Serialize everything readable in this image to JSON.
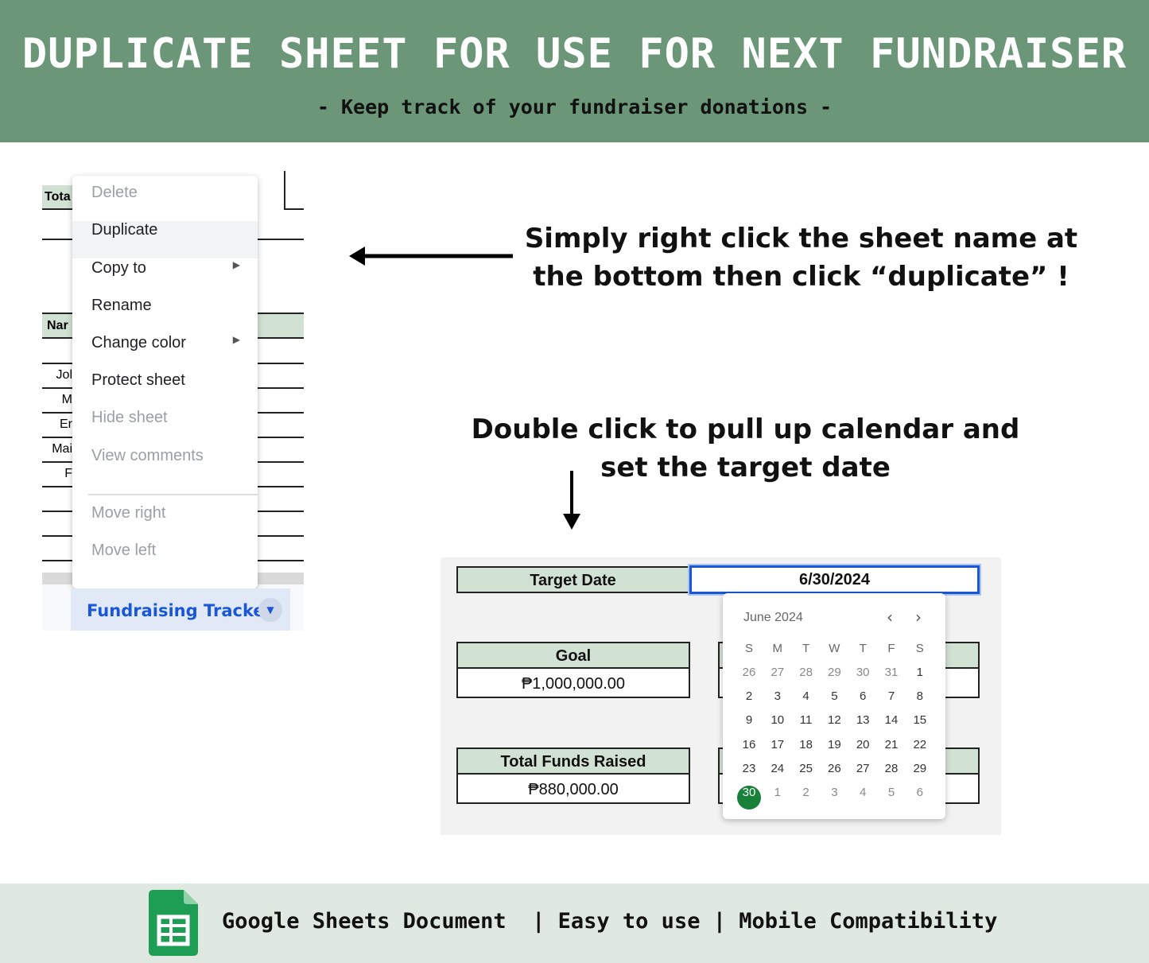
{
  "header": {
    "title": "DUPLICATE SHEET FOR USE FOR NEXT FUNDRAISER",
    "subtitle": "- Keep track of your fundraiser donations -",
    "bg": "#6b9678"
  },
  "sheet_snippet": {
    "visible_fragments": [
      "Tota",
      "Nar",
      "Jol",
      "M",
      "Er",
      "Mai",
      "F"
    ]
  },
  "context_menu": {
    "items": [
      {
        "label": "Delete",
        "disabled": true
      },
      {
        "label": "Duplicate",
        "disabled": false,
        "highlighted": true
      },
      {
        "label": "Copy to",
        "disabled": false,
        "submenu": true
      },
      {
        "label": "Rename",
        "disabled": false
      },
      {
        "label": "Change color",
        "disabled": false,
        "submenu": true
      },
      {
        "label": "Protect sheet",
        "disabled": false
      },
      {
        "label": "Hide sheet",
        "disabled": true
      },
      {
        "label": "View comments",
        "disabled": true
      },
      {
        "label": "Move right",
        "disabled": true
      },
      {
        "label": "Move left",
        "disabled": true
      }
    ]
  },
  "sheet_tab": {
    "label": "Fundraising Tracker",
    "color": "#1a57d6"
  },
  "notes": {
    "right_click": "Simply right click the sheet name at the bottom then click “duplicate” !",
    "double_click": "Double click to pull up calendar and set the target date"
  },
  "tracker": {
    "target_date_label": "Target Date",
    "target_date_value": "6/30/2024",
    "goal_label": "Goal",
    "goal_value": "₱1,000,000.00",
    "raised_label": "Total Funds Raised",
    "raised_value": "₱880,000.00"
  },
  "calendar": {
    "month": "June 2024",
    "weekdays": [
      "S",
      "M",
      "T",
      "W",
      "T",
      "F",
      "S"
    ],
    "weeks": [
      [
        "26",
        "27",
        "28",
        "29",
        "30",
        "31",
        "1"
      ],
      [
        "2",
        "3",
        "4",
        "5",
        "6",
        "7",
        "8"
      ],
      [
        "9",
        "10",
        "11",
        "12",
        "13",
        "14",
        "15"
      ],
      [
        "16",
        "17",
        "18",
        "19",
        "20",
        "21",
        "22"
      ],
      [
        "23",
        "24",
        "25",
        "26",
        "27",
        "28",
        "29"
      ],
      [
        "30",
        "1",
        "2",
        "3",
        "4",
        "5",
        "6"
      ]
    ],
    "selected": "30",
    "selected_color": "#188038"
  },
  "footer": {
    "text": "Google Sheets Document  | Easy to use | Mobile Compatibility"
  }
}
